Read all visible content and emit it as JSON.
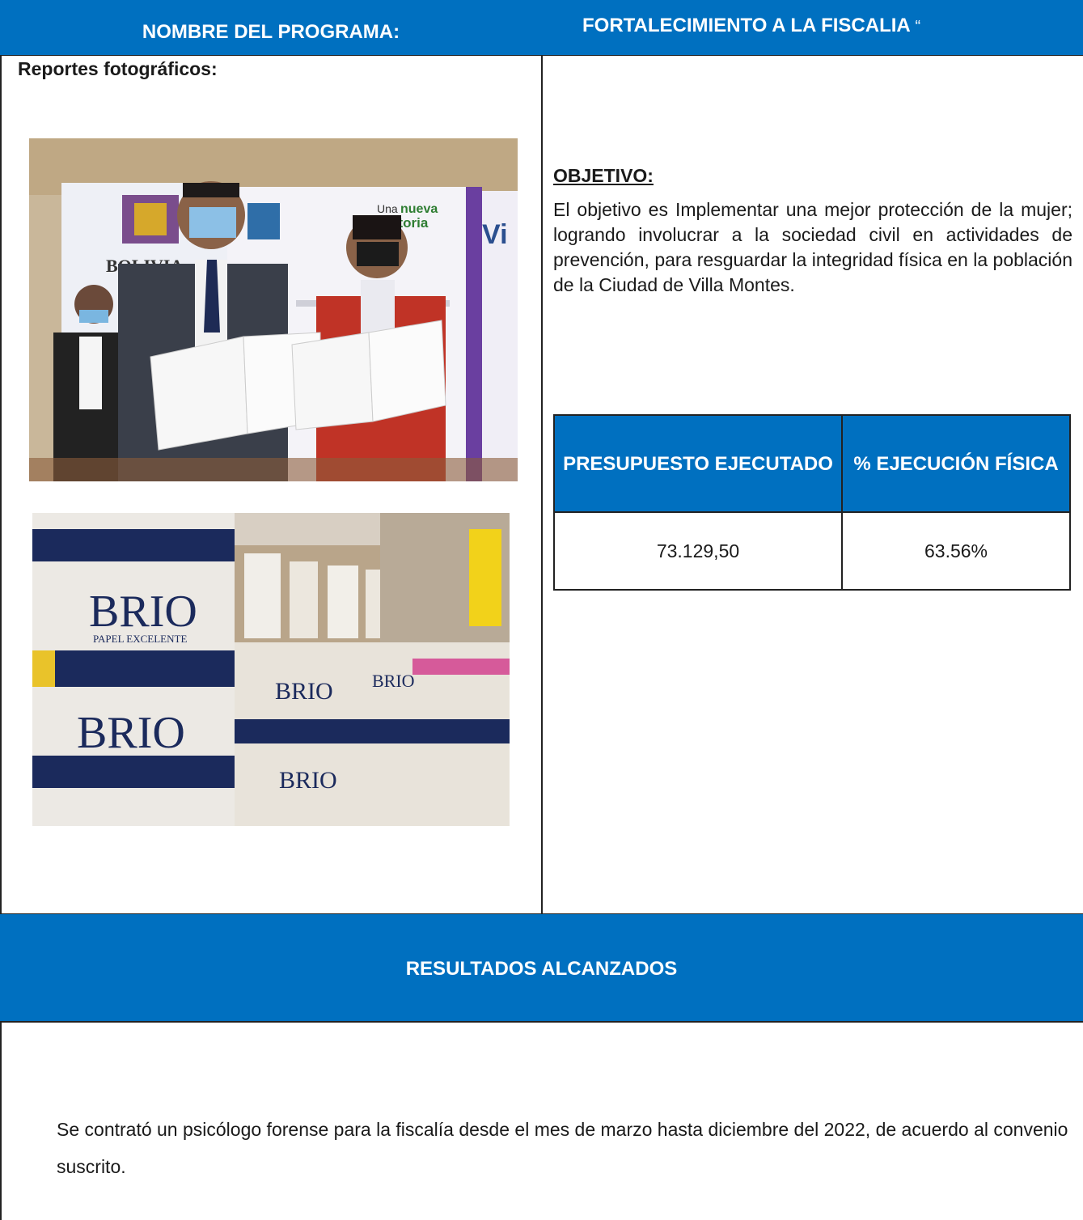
{
  "header": {
    "program_label": "NOMBRE DEL PROGRAMA:",
    "program_name": "FORTALECIMIENTO  A LA FISCALIA",
    "program_name_suffix": "“"
  },
  "left": {
    "reportes_label": "Reportes fotográficos:"
  },
  "photo1": {
    "banner_left": "BOLIVIA",
    "banner_center_a": "Una",
    "banner_center_b": "nueva",
    "banner_center_c": "Historia",
    "banner_right": "Vi"
  },
  "photo2": {
    "brand": "BRIO",
    "subtitle": "PAPEL EXCELENTE"
  },
  "objective": {
    "title": "OBJETIVO:",
    "text": "El objetivo es Implementar una mejor protección de la mujer; logrando involucrar a la sociedad civil en actividades de prevención, para resguardar la integridad física en la población de la Ciudad de Villa Montes."
  },
  "budget": {
    "col1_header": "PRESUPUESTO EJECUTADO",
    "col2_header": "% EJECUCIÓN FÍSICA",
    "col1_value": "73.129,50",
    "col2_value": "63.56%"
  },
  "results": {
    "title": "RESULTADOS ALCANZADOS",
    "text": "Se contrató un psicólogo forense para la fiscalía desde el mes de marzo hasta diciembre del 2022, de acuerdo al convenio suscrito."
  },
  "colors": {
    "header_blue": "#0070c0",
    "border": "#222222"
  }
}
